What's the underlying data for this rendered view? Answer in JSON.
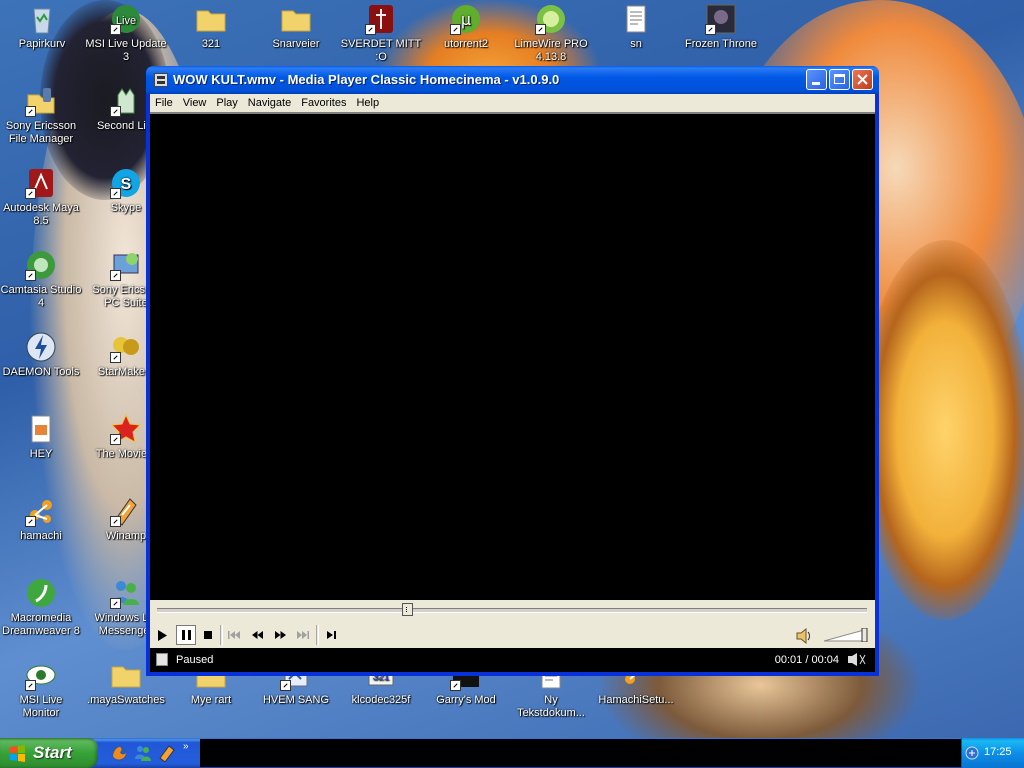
{
  "desktop": {
    "icons": [
      {
        "label": "Papirkurv",
        "icon": "recycle-bin-icon"
      },
      {
        "label": "MSI Live Update 3",
        "icon": "msi-live-update-icon"
      },
      {
        "label": "321",
        "icon": "folder-icon"
      },
      {
        "label": "Snarveier",
        "icon": "folder-icon"
      },
      {
        "label": "SVERDET MITT :O",
        "icon": "sword-app-icon"
      },
      {
        "label": "utorrent2",
        "icon": "utorrent-icon"
      },
      {
        "label": "LimeWire PRO 4.13.8",
        "icon": "limewire-icon"
      },
      {
        "label": "sn",
        "icon": "text-document-icon"
      },
      {
        "label": "Frozen Throne",
        "icon": "frozen-throne-icon"
      },
      {
        "label": "Sony Ericsson File Manager",
        "icon": "sony-ericsson-file-manager-icon"
      },
      {
        "label": "Second Li...",
        "icon": "second-life-icon"
      },
      {
        "label": "Autodesk Maya 8.5",
        "icon": "maya-icon"
      },
      {
        "label": "Skype",
        "icon": "skype-icon"
      },
      {
        "label": "Camtasia Studio 4",
        "icon": "camtasia-icon"
      },
      {
        "label": "Sony Ericss... PC Suite",
        "icon": "sony-ericsson-pc-suite-icon"
      },
      {
        "label": "DAEMON Tools",
        "icon": "daemon-tools-icon"
      },
      {
        "label": "StarMake...",
        "icon": "starmaker-icon"
      },
      {
        "label": "HEY",
        "icon": "html-document-icon"
      },
      {
        "label": "The Movie...",
        "icon": "the-movies-icon"
      },
      {
        "label": "hamachi",
        "icon": "hamachi-icon"
      },
      {
        "label": "Winamp",
        "icon": "winamp-icon"
      },
      {
        "label": "Macromedia Dreamweaver 8",
        "icon": "dreamweaver-icon"
      },
      {
        "label": "Windows L... Messenger",
        "icon": "messenger-icon"
      },
      {
        "label": "MSI Live Monitor",
        "icon": "msi-live-monitor-icon"
      },
      {
        "label": ".mayaSwatches",
        "icon": "folder-icon"
      },
      {
        "label": "Mye rart",
        "icon": "folder-icon"
      },
      {
        "label": "HVEM SANG",
        "icon": "shortcut-icon"
      },
      {
        "label": "klcodec325f",
        "icon": "codec-installer-icon"
      },
      {
        "label": "Garry's Mod",
        "icon": "garrys-mod-icon"
      },
      {
        "label": "Ny Tekstdokum...",
        "icon": "text-document-icon"
      },
      {
        "label": "HamachiSetu...",
        "icon": "hamachi-setup-icon"
      }
    ]
  },
  "window": {
    "title": "WOW KULT.wmv - Media Player Classic Homecinema - v1.0.9.0",
    "menu": [
      "File",
      "View",
      "Play",
      "Navigate",
      "Favorites",
      "Help"
    ],
    "seek_position": 0.35,
    "volume_level": 1.0,
    "status": "Paused",
    "time": "00:01 / 00:04"
  },
  "taskbar": {
    "start_label": "Start",
    "quick_launch": [
      "firefox-icon",
      "messenger-icon",
      "winamp-icon"
    ],
    "more_label": "»",
    "clock": "17:25"
  },
  "colors": {
    "titlebar": "#0058e6",
    "taskbar": "#245edb",
    "start_button": "#37a237",
    "tray": "#0c8ee8",
    "menu_bg": "#ece9d8",
    "video_bg": "#000000"
  }
}
